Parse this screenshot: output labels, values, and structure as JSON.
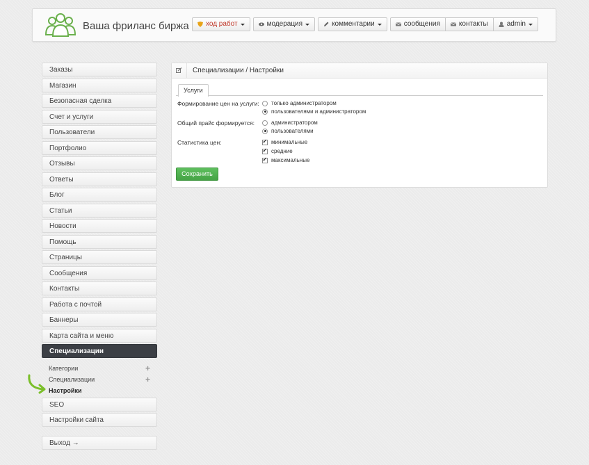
{
  "header": {
    "site_title": "Ваша фриланс биржа",
    "nav": {
      "progress": "ход работ",
      "moderation": "модерация",
      "comments": "комментарии",
      "messages": "сообщения",
      "contacts": "контакты",
      "user": "admin"
    }
  },
  "sidebar": {
    "items": [
      "Заказы",
      "Магазин",
      "Безопасная сделка",
      "Счет и услуги",
      "Пользователи",
      "Портфолио",
      "Отзывы",
      "Ответы",
      "Блог",
      "Статьи",
      "Новости",
      "Помощь",
      "Страницы",
      "Сообщения",
      "Контакты",
      "Работа с почтой",
      "Баннеры",
      "Карта сайта и меню"
    ],
    "active": "Специализации",
    "sub": {
      "categories": "Категории",
      "specializations": "Специализации",
      "settings": "Настройки"
    },
    "after": [
      "SEO",
      "Настройки сайта"
    ],
    "logout": "Выход →"
  },
  "panel": {
    "breadcrumb": "Специализации / Настройки",
    "tab": "Услуги",
    "pricing_label": "Формирование цен на услуги:",
    "pricing_opt1": "только администратором",
    "pricing_opt2": "пользователями и администратором",
    "price_list_label": "Общий прайс формируется:",
    "price_list_opt1": "администратором",
    "price_list_opt2": "пользователями",
    "stats_label": "Статистика цен:",
    "stats_opt1": "минимальные",
    "stats_opt2": "средние",
    "stats_opt3": "максимальные",
    "save": "Сохранить"
  },
  "colors": {
    "accent_green": "#5cb85c",
    "active_menu": "#3c3f45",
    "progress_red": "#c0392b"
  }
}
